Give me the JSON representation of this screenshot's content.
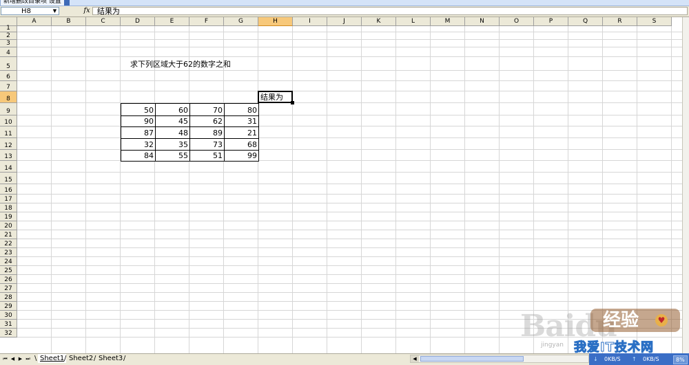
{
  "toolbar_fragment": "新增删改目录项 设置",
  "formula_bar": {
    "name_box": "H8",
    "fx_icon": "fx",
    "formula": "结果为"
  },
  "columns": [
    "A",
    "B",
    "C",
    "D",
    "E",
    "F",
    "G",
    "H",
    "I",
    "J",
    "K",
    "L",
    "M",
    "N",
    "O",
    "P",
    "Q",
    "R",
    "S"
  ],
  "rows": [
    "1",
    "2",
    "3",
    "4",
    "5",
    "6",
    "7",
    "8",
    "9",
    "10",
    "11",
    "12",
    "13",
    "14",
    "15",
    "16",
    "17",
    "18",
    "19",
    "20",
    "21",
    "22",
    "23",
    "24",
    "25",
    "26",
    "27",
    "28",
    "29",
    "30",
    "31",
    "32"
  ],
  "selected_cell": {
    "column": "H",
    "row": "8"
  },
  "sheet": {
    "instruction": "求下列区域大于62的数字之和",
    "result_label": "结果为",
    "table": [
      [
        "50",
        "60",
        "70",
        "80"
      ],
      [
        "90",
        "45",
        "62",
        "31"
      ],
      [
        "87",
        "48",
        "89",
        "21"
      ],
      [
        "32",
        "35",
        "73",
        "68"
      ],
      [
        "84",
        "55",
        "51",
        "99"
      ]
    ]
  },
  "tabs": {
    "nav_first": "⏮",
    "nav_prev": "◀",
    "nav_next": "▶",
    "nav_last": "⏭",
    "sheets": [
      "Sheet1",
      "Sheet2",
      "Sheet3"
    ],
    "active": "Sheet1"
  },
  "net_meter": {
    "download": "0KB/S",
    "upload": "0KB/S",
    "percent": "8%"
  },
  "watermark": {
    "baidu": "Baidu",
    "jingyan": "经验",
    "site": "我爱IT技术网",
    "url": "jingyan"
  }
}
